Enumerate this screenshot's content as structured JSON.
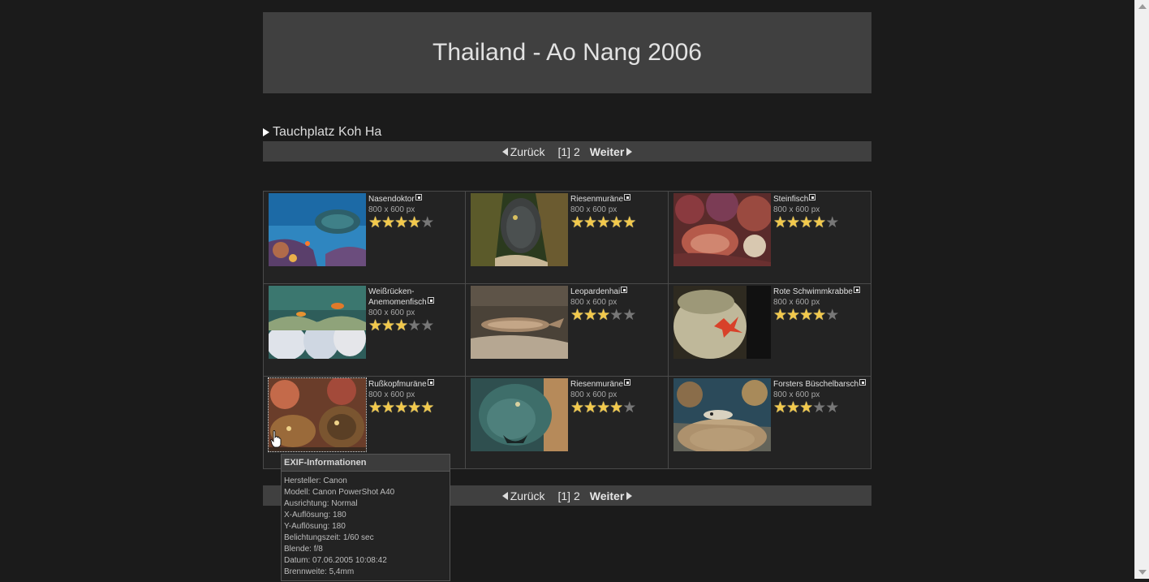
{
  "header": {
    "title": "Thailand - Ao Nang 2006"
  },
  "section": {
    "title": "Tauchplatz Koh Ha"
  },
  "pager": {
    "prev": "Zurück",
    "current_page": "[1]",
    "other_page": "2",
    "next": "Weiter"
  },
  "photos": [
    {
      "name": "Nasendoktor",
      "dims": "800 x 600 px",
      "rating": 4
    },
    {
      "name": "Riesenmuräne",
      "dims": "800 x 600 px",
      "rating": 5
    },
    {
      "name": "Steinfisch",
      "dims": "800 x 600 px",
      "rating": 4
    },
    {
      "name": "Weißrücken-Anemomenfisch",
      "dims": "800 x 600 px",
      "rating": 3
    },
    {
      "name": "Leopardenhai",
      "dims": "800 x 600 px",
      "rating": 3
    },
    {
      "name": "Rote Schwimmkrabbe",
      "dims": "800 x 600 px",
      "rating": 4
    },
    {
      "name": "Rußkopfmuräne",
      "dims": "800 x 600 px",
      "rating": 5
    },
    {
      "name": "Riesenmuräne",
      "dims": "800 x 600 px",
      "rating": 4
    },
    {
      "name": "Forsters Büschelbarsch",
      "dims": "800 x 600 px",
      "rating": 3
    }
  ],
  "rating_max": 5,
  "exif": {
    "title": "EXIF-Informationen",
    "lines": [
      "Hersteller: Canon",
      "Modell: Canon PowerShot A40",
      "Ausrichtung: Normal",
      "X-Auflösung: 180",
      "Y-Auflösung: 180",
      "Belichtungszeit: 1/60 sec",
      "Blende: f/8",
      "Datum: 07.06.2005 10:08:42",
      "Brennweite: 5,4mm"
    ]
  },
  "colors": {
    "background": "#1b1b1b",
    "panel": "#404040",
    "star_on": "#f2c94c",
    "star_off": "#777777"
  }
}
